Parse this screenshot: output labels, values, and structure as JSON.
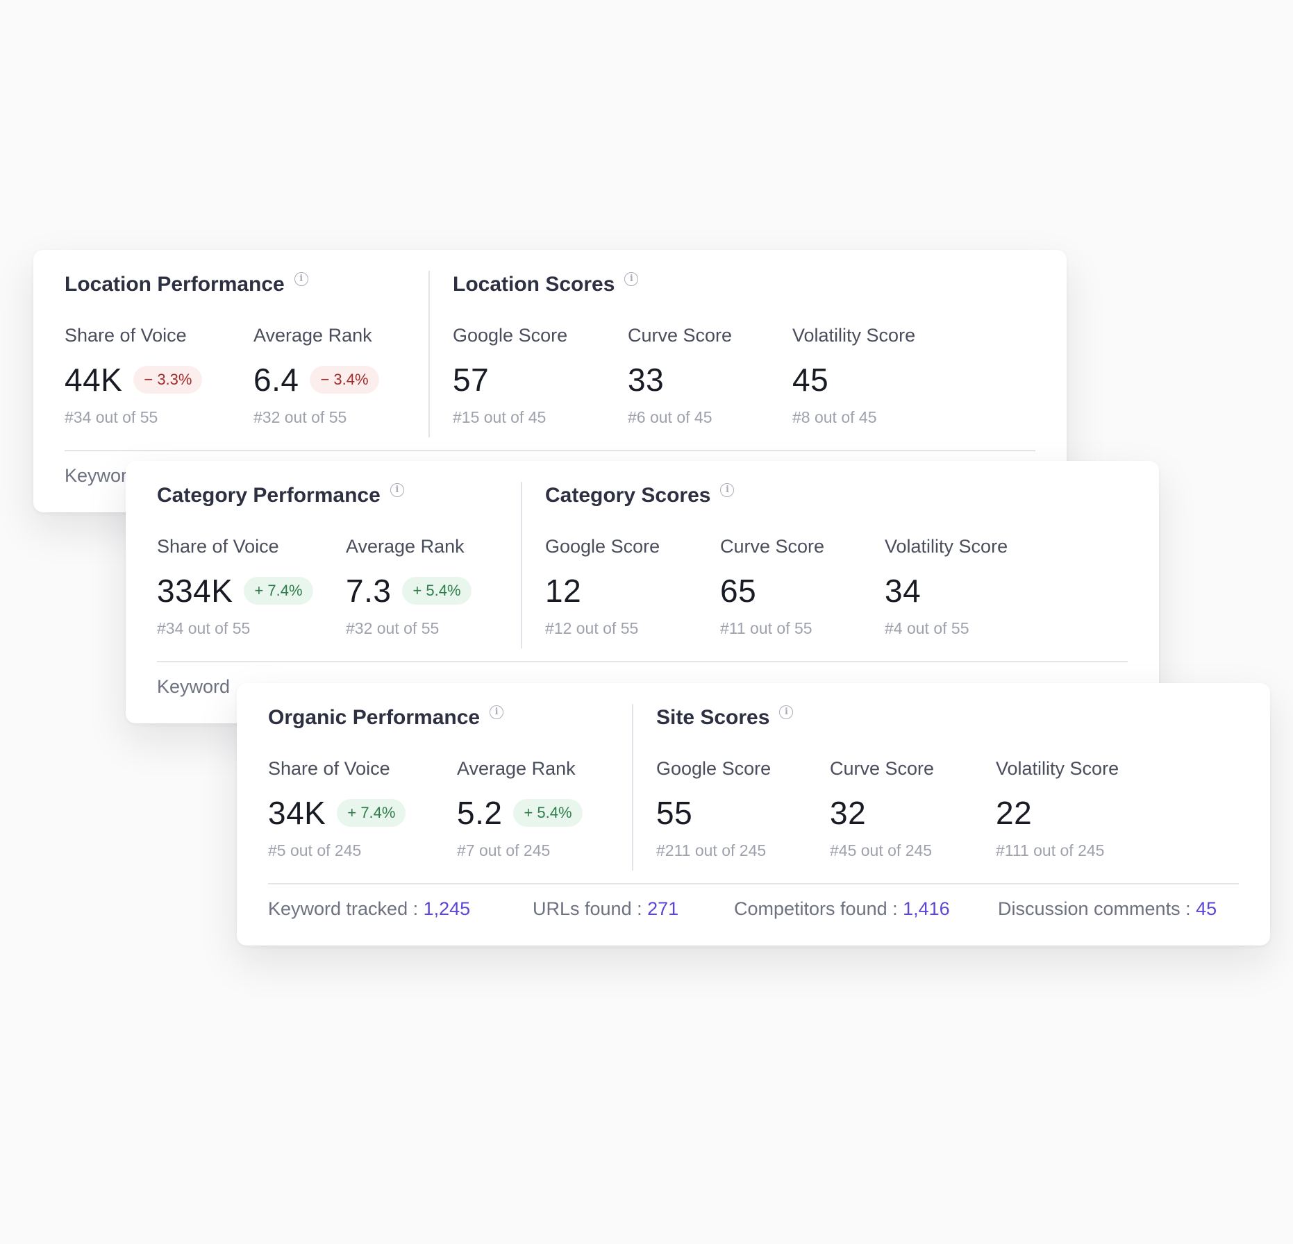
{
  "cards": [
    {
      "left_title": "Location Performance",
      "right_title": "Location Scores",
      "metrics": [
        {
          "label": "Share of Voice",
          "value": "44K",
          "badge": "− 3.3%",
          "trend": "down",
          "rank": "#34 out of 55"
        },
        {
          "label": "Average Rank",
          "value": "6.4",
          "badge": "− 3.4%",
          "trend": "down",
          "rank": "#32 out of 55"
        },
        {
          "label": "Google Score",
          "value": "57",
          "rank": "#15 out of 45"
        },
        {
          "label": "Curve Score",
          "value": "33",
          "rank": "#6 out of 45"
        },
        {
          "label": "Volatility Score",
          "value": "45",
          "rank": "#8 out of 45"
        }
      ],
      "footer": {
        "keyword_label": "Keywor"
      }
    },
    {
      "left_title": "Category Performance",
      "right_title": "Category Scores",
      "metrics": [
        {
          "label": "Share of Voice",
          "value": "334K",
          "badge": "+ 7.4%",
          "trend": "up",
          "rank": "#34 out of 55"
        },
        {
          "label": "Average Rank",
          "value": "7.3",
          "badge": "+ 5.4%",
          "trend": "up",
          "rank": "#32 out of 55"
        },
        {
          "label": "Google Score",
          "value": "12",
          "rank": "#12 out of 55"
        },
        {
          "label": "Curve Score",
          "value": "65",
          "rank": "#11 out of 55"
        },
        {
          "label": "Volatility Score",
          "value": "34",
          "rank": "#4 out of 55"
        }
      ],
      "footer": {
        "keyword_label": "Keyword"
      }
    },
    {
      "left_title": "Organic Performance",
      "right_title": "Site Scores",
      "metrics": [
        {
          "label": "Share of Voice",
          "value": "34K",
          "badge": "+ 7.4%",
          "trend": "up",
          "rank": "#5 out of 245"
        },
        {
          "label": "Average Rank",
          "value": "5.2",
          "badge": "+ 5.4%",
          "trend": "up",
          "rank": "#7 out of 245"
        },
        {
          "label": "Google Score",
          "value": "55",
          "rank": "#211 out of 245"
        },
        {
          "label": "Curve Score",
          "value": "32",
          "rank": "#45 out of 245"
        },
        {
          "label": "Volatility Score",
          "value": "22",
          "rank": "#111 out of 245"
        }
      ],
      "footer": {
        "keyword_label": "Keyword tracked : ",
        "keyword_value": "1,245",
        "urls_label": "URLs found : ",
        "urls_value": "271",
        "competitors_label": "Competitors found : ",
        "competitors_value": "1,416",
        "discussion_label": "Discussion comments : ",
        "discussion_value": "45"
      }
    }
  ],
  "info_icon": "info-icon",
  "colors": {
    "accent": "#5b47d6",
    "positive": "#2e7d4a",
    "positive_bg": "#e9f6ee",
    "negative": "#a32b2b",
    "negative_bg": "#fdeeee"
  }
}
